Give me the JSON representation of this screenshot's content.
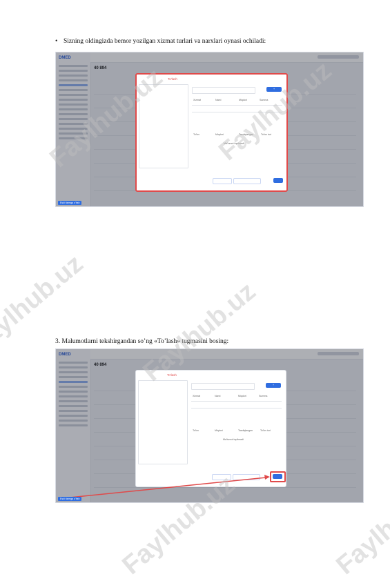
{
  "captions": {
    "bullet_symbol": "•",
    "step_text": "Sizning oldingizda bemor yozilgan xizmat turlari va narxlari oynasi ochiladi:",
    "check_text": "3. Malumotlarni tekshirgandan so’ng «To’lash» tugmasini bosing:"
  },
  "app": {
    "logo": "DMED",
    "page_number": "40 894",
    "modal_tab": "To'lash",
    "save_button": "Saqlash",
    "services_header": [
      "Xizmat",
      "Narxi",
      "Miqdori",
      "Summa"
    ],
    "payment_header": [
      "To'lov",
      "Miqdori",
      "Tasdiqlangan",
      "To'lov turi"
    ],
    "empty_text": "Ma'lumot topilmadi",
    "bottom_link": "Eski tizimga o'tish"
  },
  "watermark": "Faylhub.uz",
  "colors": {
    "accent": "#2f6de0",
    "highlight": "#e04a4a"
  }
}
